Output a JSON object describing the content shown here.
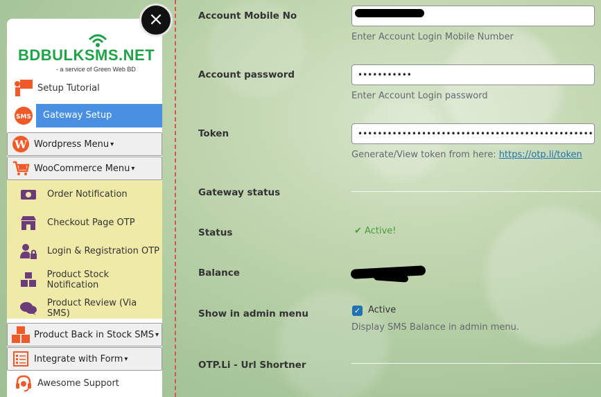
{
  "sidebar": {
    "logo": {
      "text": "BDBULKSMS.NET",
      "subtitle": "- a service of Green Web BD"
    },
    "close_label": "×",
    "items": {
      "setup_tutorial": "Setup Tutorial",
      "gateway_setup": "Gateway Setup",
      "wordpress_menu": "Wordpress Menu",
      "woocommerce_menu": "WooCommerce Menu",
      "order_notification": "Order Notification",
      "checkout_otp": "Checkout Page OTP",
      "login_registration_otp": "Login & Registration OTP",
      "product_stock_notification": "Product Stock Notification",
      "product_review": "Product Review (Via SMS)",
      "product_back_in_stock": "Product Back in Stock SMS",
      "integrate_with_form": "Integrate with Form",
      "awesome_support": "Awesome Support"
    },
    "caret": "▾"
  },
  "form": {
    "account_mobile": {
      "label": "Account Mobile No",
      "value": "",
      "hint": "Enter Account Login Mobile Number"
    },
    "account_password": {
      "label": "Account password",
      "value": "•••••••••••",
      "hint": "Enter Account Login password"
    },
    "token": {
      "label": "Token",
      "value": "•••••••••••••••••••••••••••••••••••••••••••••••••••",
      "hint_text": "Generate/View token from here: ",
      "hint_link": "https://otp.li/token"
    },
    "gateway_status": {
      "label": "Gateway status"
    },
    "status": {
      "label": "Status",
      "value": "Active!",
      "check": "✔"
    },
    "balance": {
      "label": "Balance"
    },
    "show_in_admin": {
      "label": "Show in admin menu",
      "checkbox_label": "Active",
      "checked_mark": "✓",
      "hint": "Display SMS Balance in admin menu."
    },
    "otp_li": {
      "label": "OTP.Li - Url Shortner"
    }
  },
  "colors": {
    "accent": "#4a90e2",
    "active_green": "#4a9b3a",
    "brand_green": "#1fa348",
    "submenu_bg": "#f0eaa8"
  }
}
